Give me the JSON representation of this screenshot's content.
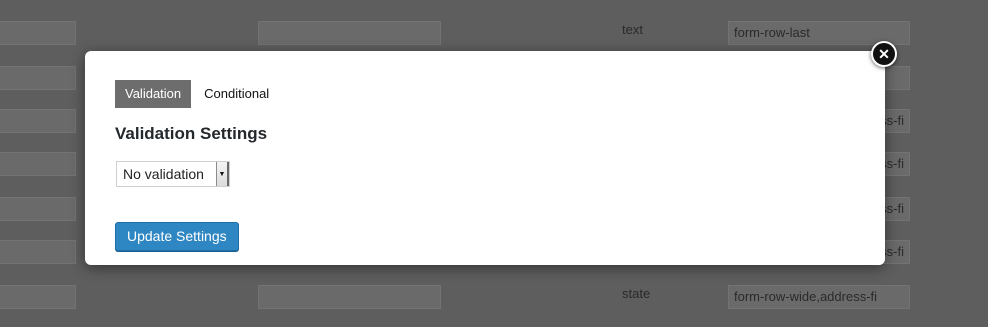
{
  "background": {
    "row1_type": "text",
    "row1_class": "form-row-last",
    "row_class_fragment": "ss-fi",
    "row_class_fragment_alt": "ess-fi",
    "last_type": "state",
    "last_class": "form-row-wide,address-fi"
  },
  "modal": {
    "tabs": [
      "Validation",
      "Conditional"
    ],
    "title": "Validation Settings",
    "select_value": "No validation",
    "update_button": "Update Settings",
    "close_icon": "close-circle-icon"
  },
  "colors": {
    "active_tab": "#6d6d6d",
    "primary_button": "#2e86c2",
    "overlay": "#5e5e5e"
  }
}
